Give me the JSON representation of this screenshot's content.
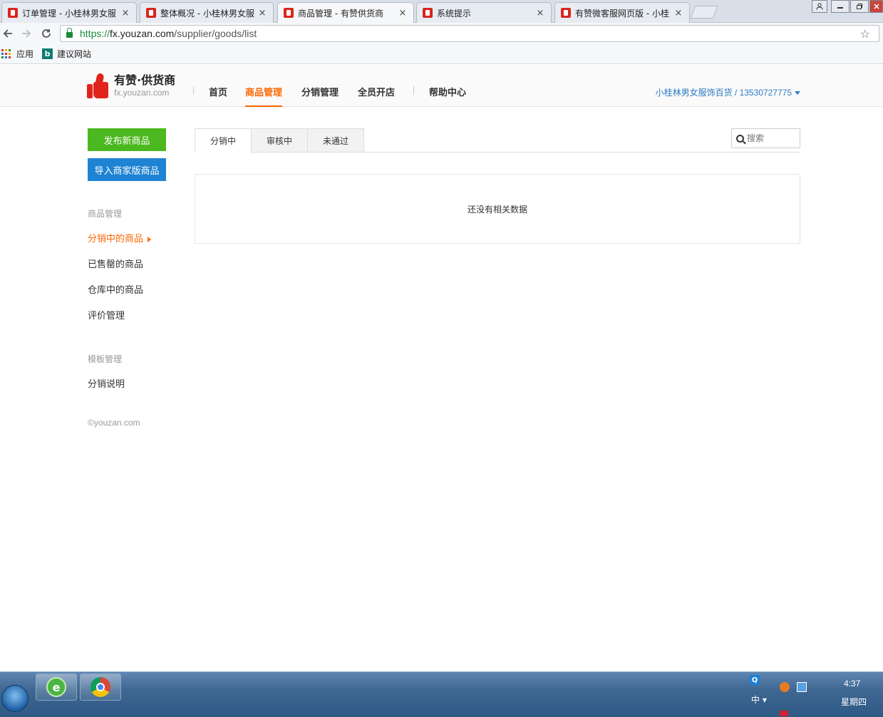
{
  "browser": {
    "tabs": [
      {
        "title": "订单管理 - 小桂林男女服",
        "active": false
      },
      {
        "title": "整体概况 - 小桂林男女服",
        "active": false
      },
      {
        "title": "商品管理 - 有赞供货商",
        "active": true
      },
      {
        "title": "系统提示",
        "active": false
      },
      {
        "title": "有赞微客服网页版 - 小桂",
        "active": false
      }
    ],
    "tab_close_glyph": "×",
    "url_scheme": "https://",
    "url_host": "fx.youzan.com",
    "url_path": "/supplier/goods/list",
    "bookmarks": {
      "apps_label": "应用",
      "suggested_label": "建议网站"
    }
  },
  "header": {
    "logo_title": "有赞·供货商",
    "logo_subtitle": "fx.youzan.com",
    "nav": [
      {
        "label": "首页",
        "active": false
      },
      {
        "label": "商品管理",
        "active": true
      },
      {
        "label": "分销管理",
        "active": false
      },
      {
        "label": "全员开店",
        "active": false
      },
      {
        "label": "帮助中心",
        "active": false
      }
    ],
    "account": "小桂林男女服饰百货 / 13530727775",
    "brand_color": "#e0241b",
    "accent_color": "#ff6600",
    "link_color": "#2d7bc4"
  },
  "sidebar": {
    "publish_button": "发布新商品",
    "import_button": "导入商家版商品",
    "publish_color": "#4cb81f",
    "import_color": "#1f83d3",
    "sections": [
      {
        "heading": "商品管理",
        "items": [
          {
            "label": "分销中的商品",
            "active": true
          },
          {
            "label": "已售罄的商品",
            "active": false
          },
          {
            "label": "仓库中的商品",
            "active": false
          },
          {
            "label": "评价管理",
            "active": false
          }
        ]
      },
      {
        "heading": "模板管理",
        "items": [
          {
            "label": "分销说明",
            "active": false
          }
        ]
      }
    ],
    "copyright": "©youzan.com"
  },
  "content": {
    "tabs": [
      {
        "label": "分销中",
        "active": true
      },
      {
        "label": "审核中",
        "active": false
      },
      {
        "label": "未通过",
        "active": false
      }
    ],
    "search_placeholder": "搜索",
    "empty_message": "还没有相关数据"
  },
  "taskbar": {
    "ime_label": "中",
    "tray_q_label": "Q",
    "clock_time": "4:37",
    "clock_day": "星期四"
  }
}
